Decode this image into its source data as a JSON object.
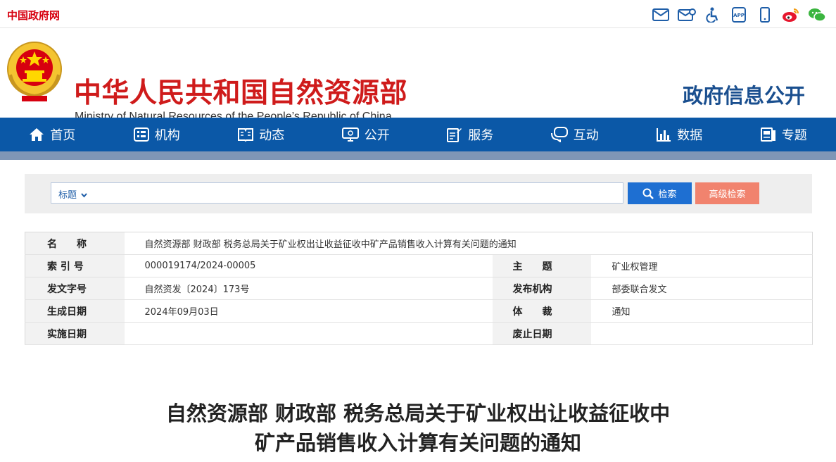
{
  "topbar": {
    "gov_link": "中国政府网",
    "icons": [
      "mail-icon",
      "email-icon",
      "accessibility-icon",
      "app-icon",
      "mobile-icon",
      "weibo-icon",
      "wechat-icon"
    ]
  },
  "header": {
    "cn_title": "中华人民共和国自然资源部",
    "en_title": "Ministry of Natural Resources of the People’s Republic of China",
    "section_title": "政府信息公开"
  },
  "nav": {
    "items": [
      {
        "label": "首页",
        "icon": "home-icon"
      },
      {
        "label": "机构",
        "icon": "org-icon"
      },
      {
        "label": "动态",
        "icon": "news-icon"
      },
      {
        "label": "公开",
        "icon": "disclosure-icon"
      },
      {
        "label": "服务",
        "icon": "service-icon"
      },
      {
        "label": "互动",
        "icon": "chat-icon"
      },
      {
        "label": "数据",
        "icon": "chart-icon"
      },
      {
        "label": "专题",
        "icon": "topic-icon"
      }
    ]
  },
  "search": {
    "field_select": "标题",
    "search_label": "检索",
    "advanced_label": "高级检索"
  },
  "info": {
    "name_label": "名　　称",
    "name_value": "自然资源部 财政部 税务总局关于矿业权出让收益征收中矿产品销售收入计算有关问题的通知",
    "index_label": "索 引 号",
    "index_value": "000019174/2024-00005",
    "subject_label": "主　　题",
    "subject_value": "矿业权管理",
    "doc_no_label": "发文字号",
    "doc_no_value": "自然资发〔2024〕173号",
    "issuer_label": "发布机构",
    "issuer_value": "部委联合发文",
    "date_label": "生成日期",
    "date_value": "2024年09月03日",
    "genre_label": "体　　裁",
    "genre_value": "通知",
    "effective_label": "实施日期",
    "effective_value": "",
    "abolish_label": "废止日期",
    "abolish_value": ""
  },
  "article": {
    "title_line1": "自然资源部 财政部 税务总局关于矿业权出让收益征收中",
    "title_line2": "矿产品销售收入计算有关问题的通知"
  },
  "colors": {
    "brand_red": "#cf1b1b",
    "nav_blue": "#0b58a7",
    "search_button": "#1e6fd2",
    "advanced_button": "#f1836e"
  }
}
